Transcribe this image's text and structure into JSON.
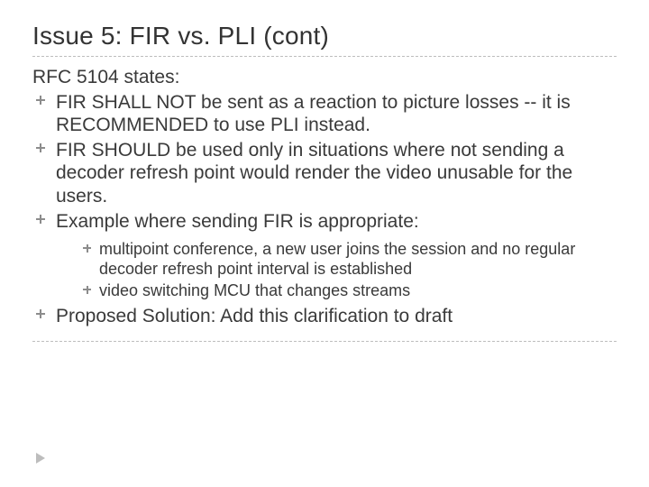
{
  "slide": {
    "title": "Issue 5: FIR vs. PLI (cont)",
    "lead": "RFC 5104 states:",
    "bullets": [
      {
        "text": "FIR SHALL NOT be sent as a reaction to picture losses -- it is RECOMMENDED to use PLI instead."
      },
      {
        "text": "FIR SHOULD be used only in situations where not sending a decoder refresh point would render the video unusable for the users."
      },
      {
        "text": "Example where sending FIR is appropriate:",
        "sub": [
          "multipoint conference, a new user joins the session and no regular decoder refresh point interval is established",
          "video switching MCU that changes streams"
        ]
      },
      {
        "text": "Proposed Solution:  Add this clarification to draft"
      }
    ]
  }
}
